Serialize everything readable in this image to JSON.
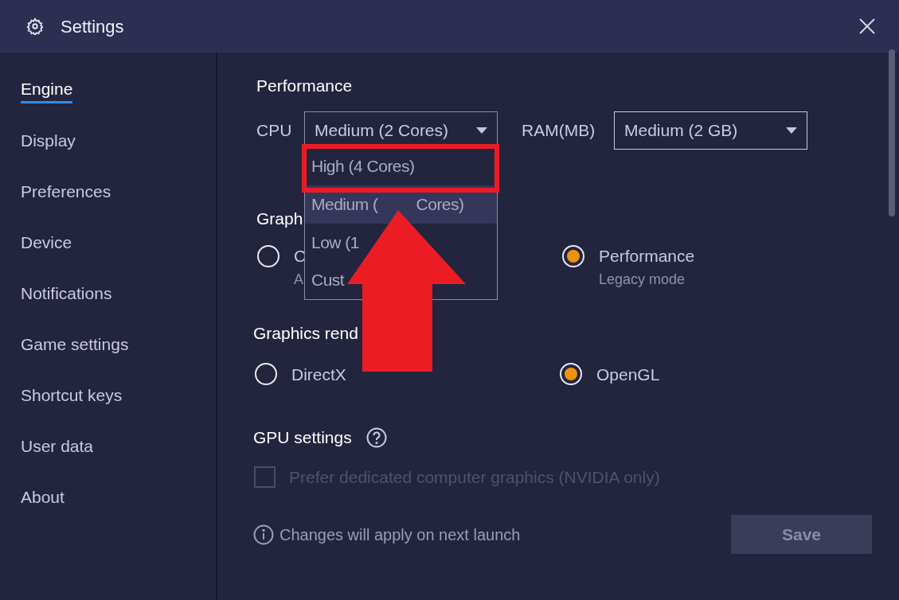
{
  "window": {
    "title": "Settings"
  },
  "sidebar": {
    "items": [
      {
        "label": "Engine",
        "selected": true
      },
      {
        "label": "Display",
        "selected": false
      },
      {
        "label": "Preferences",
        "selected": false
      },
      {
        "label": "Device",
        "selected": false
      },
      {
        "label": "Notifications",
        "selected": false
      },
      {
        "label": "Game settings",
        "selected": false
      },
      {
        "label": "Shortcut keys",
        "selected": false
      },
      {
        "label": "User data",
        "selected": false
      },
      {
        "label": "About",
        "selected": false
      }
    ]
  },
  "performance": {
    "heading": "Performance",
    "cpu": {
      "label": "CPU",
      "value": "Medium (2 Cores)"
    },
    "ram": {
      "label": "RAM(MB)",
      "value": "Medium (2 GB)"
    }
  },
  "cpu_menu": {
    "options": [
      {
        "label": "High (4 Cores)",
        "selected": false,
        "highlighted": true
      },
      {
        "label": "Medium (",
        "label_end": "Cores)",
        "selected": true,
        "highlighted": false
      },
      {
        "label": "Low (1",
        "selected": false,
        "highlighted": false
      },
      {
        "label": "Cust",
        "selected": false,
        "highlighted": false
      }
    ]
  },
  "graphics_mode": {
    "heading": "Graph",
    "options": [
      {
        "label": "C",
        "sub": "A",
        "selected": false
      },
      {
        "label": "Performance",
        "sub": "Legacy mode",
        "selected": true
      }
    ]
  },
  "graphics_renderer": {
    "heading": "Graphics rend",
    "options": [
      {
        "label": "DirectX",
        "selected": false
      },
      {
        "label": "OpenGL",
        "selected": true
      }
    ]
  },
  "gpu": {
    "heading": "GPU settings",
    "checkbox": {
      "label": "Prefer dedicated computer graphics (NVIDIA only)",
      "checked": false,
      "disabled": true
    }
  },
  "footer": {
    "note": "Changes will apply on next launch",
    "save": "Save"
  }
}
